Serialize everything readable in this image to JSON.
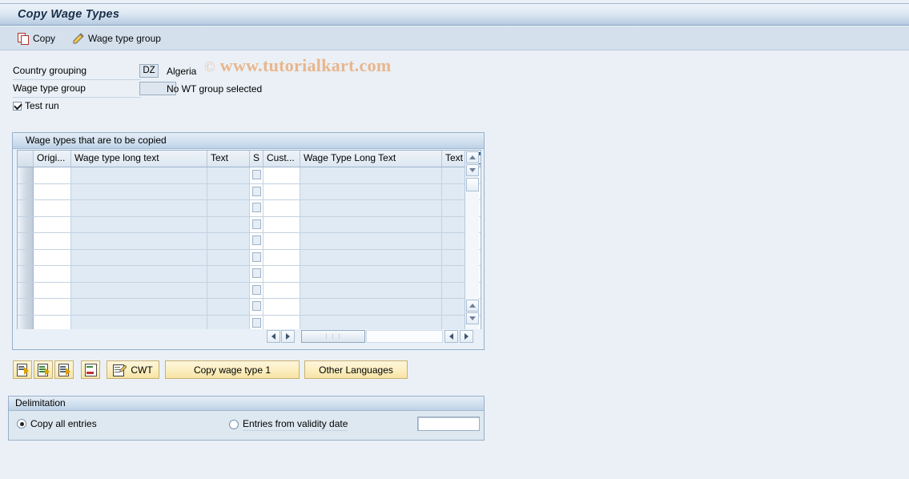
{
  "window": {
    "title": "Copy Wage Types"
  },
  "toolbar": {
    "copy_label": "Copy",
    "copy_icon": "copy-icon",
    "wage_type_group_label": "Wage type group",
    "wage_type_group_icon": "pencil-icon"
  },
  "watermark": {
    "copyright": "©",
    "text": "www.tutorialkart.com"
  },
  "form": {
    "country_grouping": {
      "label": "Country grouping",
      "value": "DZ",
      "description": "Algeria"
    },
    "wage_type_group": {
      "label": "Wage type group",
      "value": "",
      "description": "No WT group selected"
    },
    "test_run": {
      "label": "Test run",
      "checked": true
    }
  },
  "table": {
    "group_title": "Wage types that are to be copied",
    "columns": [
      {
        "key": "select",
        "label": ""
      },
      {
        "key": "origin",
        "label": "Origi..."
      },
      {
        "key": "wage_type_long_text",
        "label": "Wage type long text"
      },
      {
        "key": "text1",
        "label": "Text"
      },
      {
        "key": "s",
        "label": "S"
      },
      {
        "key": "cust",
        "label": "Cust..."
      },
      {
        "key": "wage_type_long_text_2",
        "label": "Wage Type Long Text"
      },
      {
        "key": "text2",
        "label": "Text"
      }
    ],
    "config_icon": "column-config-icon",
    "row_count": 10,
    "rows": [
      {
        "origin": "",
        "wage_type_long_text": "",
        "text1": "",
        "s": false,
        "cust": "",
        "wage_type_long_text_2": "",
        "text2": ""
      },
      {
        "origin": "",
        "wage_type_long_text": "",
        "text1": "",
        "s": false,
        "cust": "",
        "wage_type_long_text_2": "",
        "text2": ""
      },
      {
        "origin": "",
        "wage_type_long_text": "",
        "text1": "",
        "s": false,
        "cust": "",
        "wage_type_long_text_2": "",
        "text2": ""
      },
      {
        "origin": "",
        "wage_type_long_text": "",
        "text1": "",
        "s": false,
        "cust": "",
        "wage_type_long_text_2": "",
        "text2": ""
      },
      {
        "origin": "",
        "wage_type_long_text": "",
        "text1": "",
        "s": false,
        "cust": "",
        "wage_type_long_text_2": "",
        "text2": ""
      },
      {
        "origin": "",
        "wage_type_long_text": "",
        "text1": "",
        "s": false,
        "cust": "",
        "wage_type_long_text_2": "",
        "text2": ""
      },
      {
        "origin": "",
        "wage_type_long_text": "",
        "text1": "",
        "s": false,
        "cust": "",
        "wage_type_long_text_2": "",
        "text2": ""
      },
      {
        "origin": "",
        "wage_type_long_text": "",
        "text1": "",
        "s": false,
        "cust": "",
        "wage_type_long_text_2": "",
        "text2": ""
      },
      {
        "origin": "",
        "wage_type_long_text": "",
        "text1": "",
        "s": false,
        "cust": "",
        "wage_type_long_text_2": "",
        "text2": ""
      },
      {
        "origin": "",
        "wage_type_long_text": "",
        "text1": "",
        "s": false,
        "cust": "",
        "wage_type_long_text_2": "",
        "text2": ""
      }
    ]
  },
  "actions": {
    "icon_buttons": [
      {
        "name": "insert-entry-button",
        "icon": "document-arrow-icon"
      },
      {
        "name": "copy-entry-button",
        "icon": "document-lines-green-icon"
      },
      {
        "name": "paste-entry-button",
        "icon": "document-lines-icon"
      },
      {
        "name": "delete-entry-button",
        "icon": "document-delete-icon"
      }
    ],
    "cwt_label": "CWT",
    "cwt_icon": "document-pencil-icon",
    "copy_wage_type_label": "Copy wage type 1",
    "other_languages_label": "Other Languages"
  },
  "delimitation": {
    "group_title": "Delimitation",
    "copy_all_entries": {
      "label": "Copy all entries",
      "selected": true
    },
    "entries_from_validity_date": {
      "label": "Entries from validity date",
      "selected": false,
      "value": ""
    }
  },
  "colors": {
    "background": "#eaf0f6",
    "title_bar": "#b9cde3",
    "toolbar": "#d4e0ec",
    "button_yellow": "#fbeec0",
    "watermark": "#e9b68c",
    "group_border": "#97b0ca"
  }
}
